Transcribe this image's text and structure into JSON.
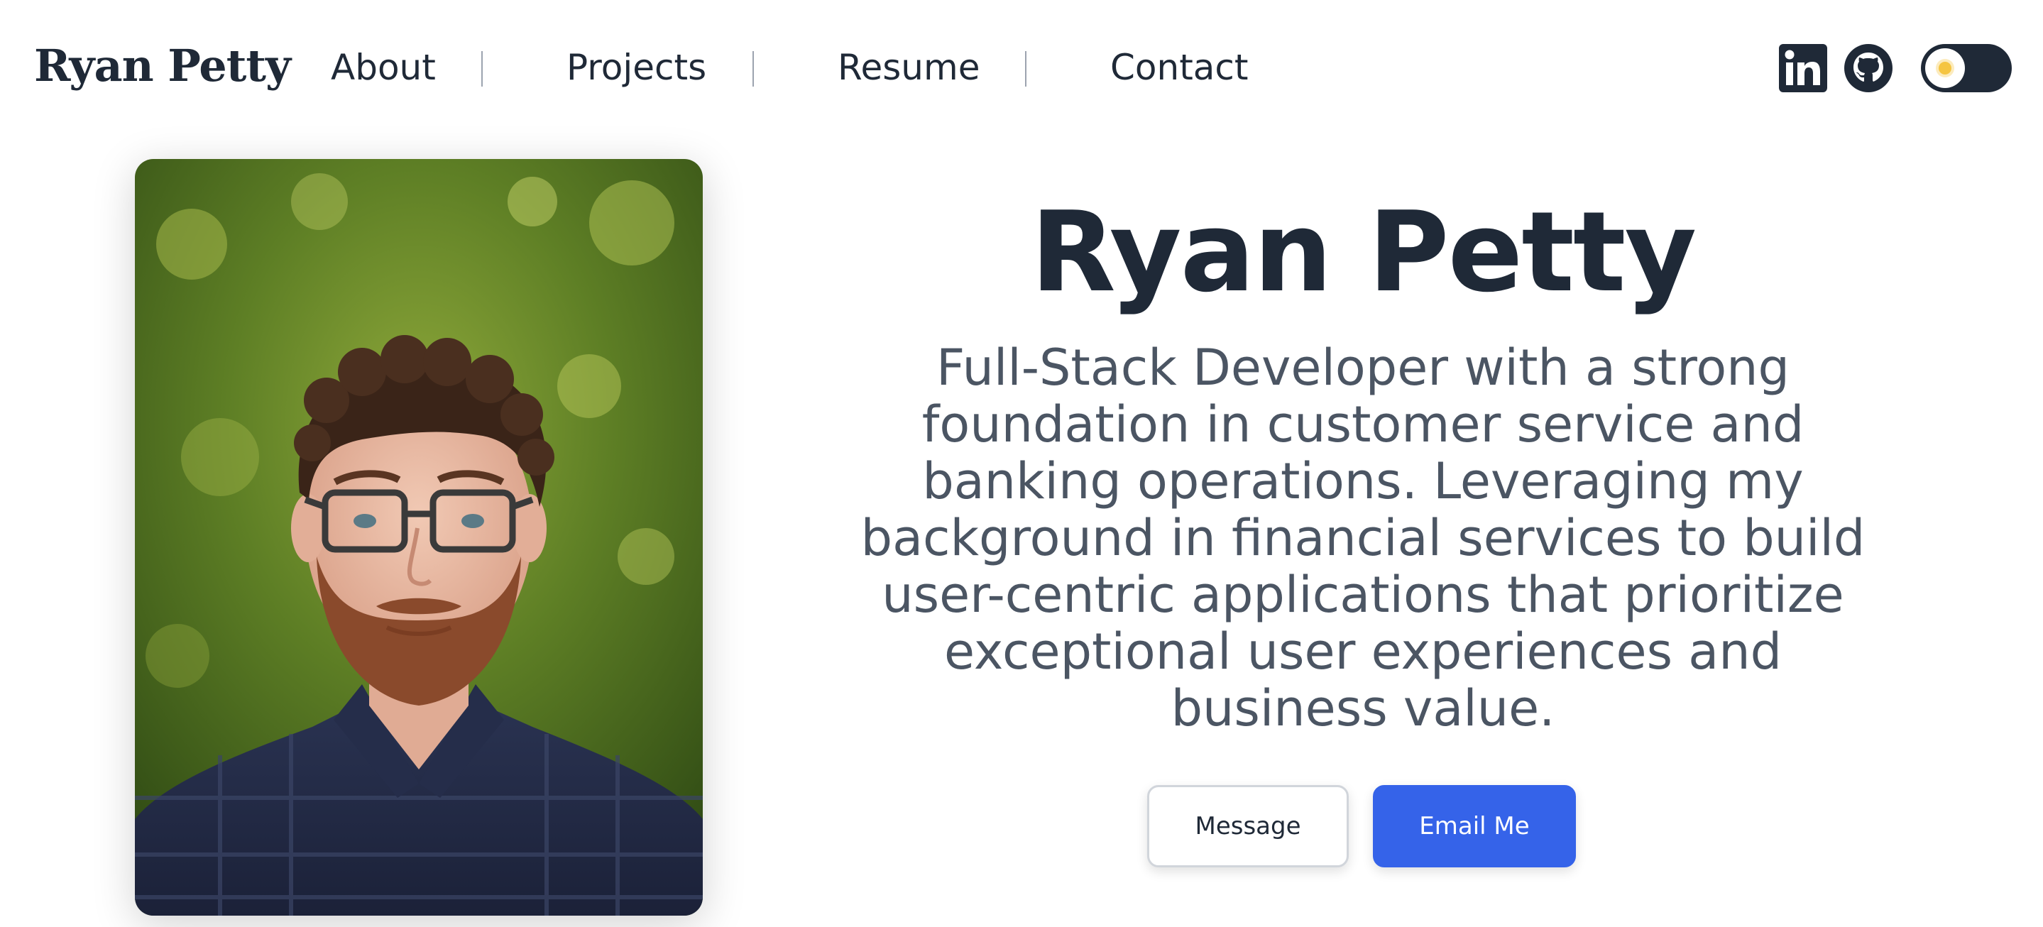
{
  "header": {
    "brand": "Ryan Petty",
    "nav": [
      {
        "label": "About"
      },
      {
        "label": "Projects"
      },
      {
        "label": "Resume"
      },
      {
        "label": "Contact"
      }
    ],
    "social": {
      "linkedin_icon": "linkedin-icon",
      "github_icon": "github-icon"
    },
    "theme_toggle": {
      "state": "light",
      "icon": "sun-icon"
    }
  },
  "hero": {
    "name": "Ryan Petty",
    "bio": "Full-Stack Developer with a strong foundation in customer service and banking operations. Leveraging my background in financial services to build user-centric applications that prioritize exceptional user experiences and business value.",
    "buttons": {
      "message": "Message",
      "email": "Email Me"
    },
    "photo_icon": "profile-photo"
  },
  "colors": {
    "primary": "#3563e9",
    "text_dark": "#1f2937",
    "text_muted": "#4b5563"
  }
}
